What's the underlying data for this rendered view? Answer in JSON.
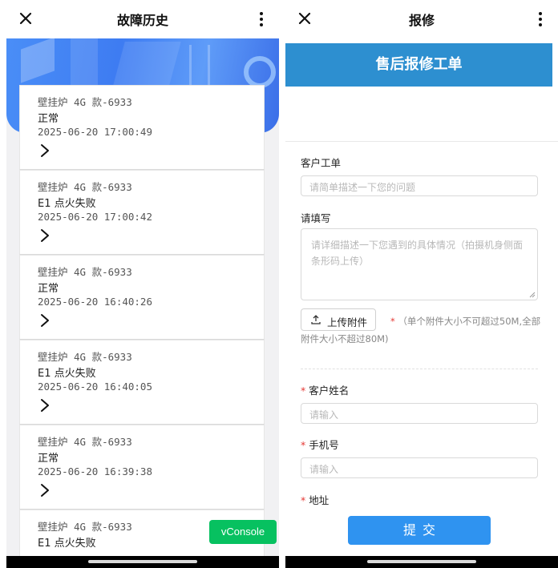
{
  "left": {
    "title": "故障历史",
    "records": [
      {
        "device": "壁挂炉 4G 款-6933",
        "status": "正常",
        "time": "2025-06-20 17:00:49"
      },
      {
        "device": "壁挂炉 4G 款-6933",
        "status": "E1 点火失败",
        "time": "2025-06-20 17:00:42"
      },
      {
        "device": "壁挂炉 4G 款-6933",
        "status": "正常",
        "time": "2025-06-20 16:40:26"
      },
      {
        "device": "壁挂炉 4G 款-6933",
        "status": "E1 点火失败",
        "time": "2025-06-20 16:40:05"
      },
      {
        "device": "壁挂炉 4G 款-6933",
        "status": "正常",
        "time": "2025-06-20 16:39:38"
      },
      {
        "device": "壁挂炉 4G 款-6933",
        "status": "E1 点火失败",
        "time": ""
      }
    ],
    "vconsole_label": "vConsole"
  },
  "right": {
    "title": "报修",
    "form_title": "售后报修工单",
    "ticket_label": "客户工单",
    "ticket_placeholder": "请简单描述一下您的问题",
    "detail_label": "请填写",
    "detail_placeholder": "请详细描述一下您遇到的具体情况（拍摄机身侧面条形码上传）",
    "upload_label": "上传附件",
    "upload_note": "（单个附件大小不可超过50M,全部附件大小不超过80M)",
    "required_mark": "*",
    "name_label": "客户姓名",
    "name_placeholder": "请输入",
    "phone_label": "手机号",
    "phone_placeholder": "请输入",
    "address_label": "地址",
    "submit_label": "提交"
  },
  "icons": {
    "close": "close-icon",
    "more": "more-vertical-icon",
    "chevron": "chevron-right-icon",
    "upload": "upload-icon"
  },
  "colors": {
    "brand_blue": "#2d8fd0",
    "submit_blue": "#2f93f0",
    "vconsole_green": "#07c160",
    "required_red": "#e53935"
  }
}
